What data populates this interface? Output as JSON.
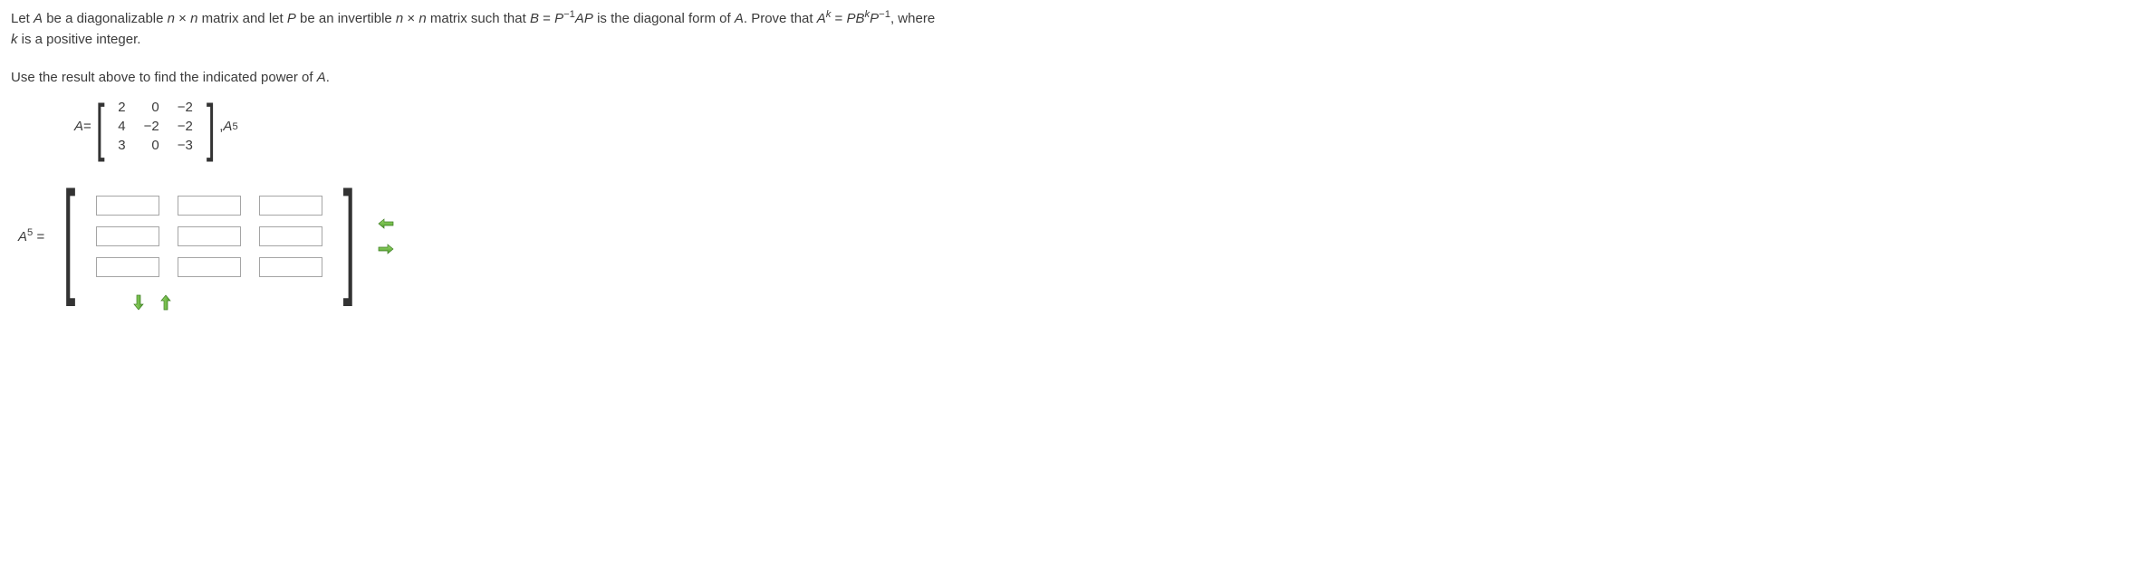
{
  "problem": {
    "line1_parts": {
      "p1": "Let ",
      "A": "A",
      "p2": " be a diagonalizable ",
      "n": "n",
      "times": " × ",
      "p3": " matrix and let ",
      "P": "P",
      "p4": " be an invertible ",
      "p5": " matrix such that  ",
      "B": "B",
      "eq": " = ",
      "Pinv": "P",
      "neg1": "−1",
      "AP": "AP",
      "p6": "  is the diagonal form of ",
      "p7": ". Prove that  ",
      "Ak_A": "A",
      "Ak_k": "k",
      "PBk": "PB",
      "PBk_k": "k",
      "Pend": "P",
      "p8": ",  where"
    },
    "line2": "k",
    "line2_rest": " is a positive integer."
  },
  "prompt2": "Use the result above to find the indicated power of ",
  "prompt2_A": "A",
  "prompt2_end": ".",
  "matrix_label_A": "A",
  "matrix_label_eq": " = ",
  "matrix_A": [
    [
      "2",
      "0",
      "−2"
    ],
    [
      "4",
      "−2",
      "−2"
    ],
    [
      "3",
      "0",
      "−3"
    ]
  ],
  "after_matrix_comma": ", ",
  "after_matrix_A": "A",
  "after_matrix_power": "5",
  "answer_label_A": "A",
  "answer_label_power": "5",
  "answer_label_eq": " = ",
  "answer_matrix": [
    [
      "",
      "",
      ""
    ],
    [
      "",
      "",
      ""
    ],
    [
      "",
      "",
      ""
    ]
  ],
  "icons": {
    "remove_col": "remove-column",
    "add_col": "add-column",
    "remove_row": "remove-row",
    "add_row": "add-row"
  }
}
